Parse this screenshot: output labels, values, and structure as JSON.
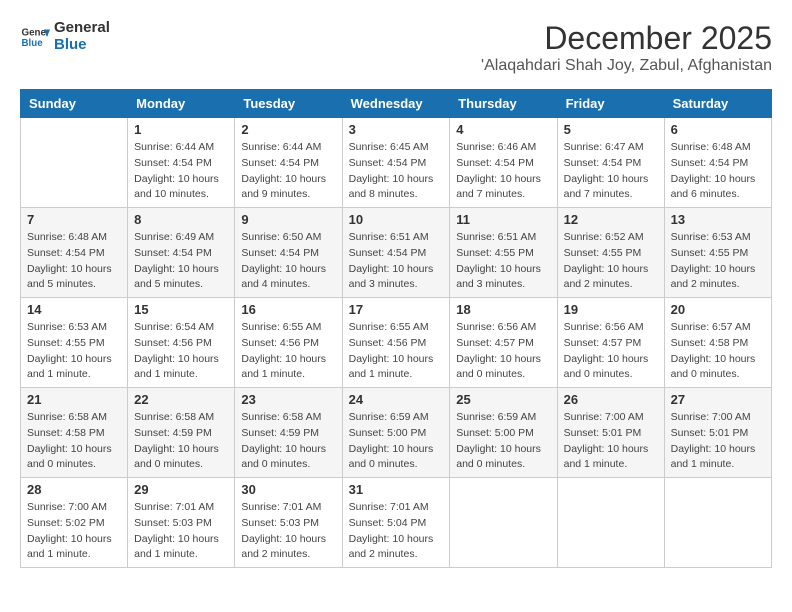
{
  "logo": {
    "line1": "General",
    "line2": "Blue"
  },
  "title": "December 2025",
  "location": "'Alaqahdari Shah Joy, Zabul, Afghanistan",
  "weekdays": [
    "Sunday",
    "Monday",
    "Tuesday",
    "Wednesday",
    "Thursday",
    "Friday",
    "Saturday"
  ],
  "weeks": [
    [
      null,
      {
        "day": 1,
        "sunrise": "6:44 AM",
        "sunset": "4:54 PM",
        "daylight": "10 hours and 10 minutes."
      },
      {
        "day": 2,
        "sunrise": "6:44 AM",
        "sunset": "4:54 PM",
        "daylight": "10 hours and 9 minutes."
      },
      {
        "day": 3,
        "sunrise": "6:45 AM",
        "sunset": "4:54 PM",
        "daylight": "10 hours and 8 minutes."
      },
      {
        "day": 4,
        "sunrise": "6:46 AM",
        "sunset": "4:54 PM",
        "daylight": "10 hours and 7 minutes."
      },
      {
        "day": 5,
        "sunrise": "6:47 AM",
        "sunset": "4:54 PM",
        "daylight": "10 hours and 7 minutes."
      },
      {
        "day": 6,
        "sunrise": "6:48 AM",
        "sunset": "4:54 PM",
        "daylight": "10 hours and 6 minutes."
      }
    ],
    [
      {
        "day": 7,
        "sunrise": "6:48 AM",
        "sunset": "4:54 PM",
        "daylight": "10 hours and 5 minutes."
      },
      {
        "day": 8,
        "sunrise": "6:49 AM",
        "sunset": "4:54 PM",
        "daylight": "10 hours and 5 minutes."
      },
      {
        "day": 9,
        "sunrise": "6:50 AM",
        "sunset": "4:54 PM",
        "daylight": "10 hours and 4 minutes."
      },
      {
        "day": 10,
        "sunrise": "6:51 AM",
        "sunset": "4:54 PM",
        "daylight": "10 hours and 3 minutes."
      },
      {
        "day": 11,
        "sunrise": "6:51 AM",
        "sunset": "4:55 PM",
        "daylight": "10 hours and 3 minutes."
      },
      {
        "day": 12,
        "sunrise": "6:52 AM",
        "sunset": "4:55 PM",
        "daylight": "10 hours and 2 minutes."
      },
      {
        "day": 13,
        "sunrise": "6:53 AM",
        "sunset": "4:55 PM",
        "daylight": "10 hours and 2 minutes."
      }
    ],
    [
      {
        "day": 14,
        "sunrise": "6:53 AM",
        "sunset": "4:55 PM",
        "daylight": "10 hours and 1 minute."
      },
      {
        "day": 15,
        "sunrise": "6:54 AM",
        "sunset": "4:56 PM",
        "daylight": "10 hours and 1 minute."
      },
      {
        "day": 16,
        "sunrise": "6:55 AM",
        "sunset": "4:56 PM",
        "daylight": "10 hours and 1 minute."
      },
      {
        "day": 17,
        "sunrise": "6:55 AM",
        "sunset": "4:56 PM",
        "daylight": "10 hours and 1 minute."
      },
      {
        "day": 18,
        "sunrise": "6:56 AM",
        "sunset": "4:57 PM",
        "daylight": "10 hours and 0 minutes."
      },
      {
        "day": 19,
        "sunrise": "6:56 AM",
        "sunset": "4:57 PM",
        "daylight": "10 hours and 0 minutes."
      },
      {
        "day": 20,
        "sunrise": "6:57 AM",
        "sunset": "4:58 PM",
        "daylight": "10 hours and 0 minutes."
      }
    ],
    [
      {
        "day": 21,
        "sunrise": "6:58 AM",
        "sunset": "4:58 PM",
        "daylight": "10 hours and 0 minutes."
      },
      {
        "day": 22,
        "sunrise": "6:58 AM",
        "sunset": "4:59 PM",
        "daylight": "10 hours and 0 minutes."
      },
      {
        "day": 23,
        "sunrise": "6:58 AM",
        "sunset": "4:59 PM",
        "daylight": "10 hours and 0 minutes."
      },
      {
        "day": 24,
        "sunrise": "6:59 AM",
        "sunset": "5:00 PM",
        "daylight": "10 hours and 0 minutes."
      },
      {
        "day": 25,
        "sunrise": "6:59 AM",
        "sunset": "5:00 PM",
        "daylight": "10 hours and 0 minutes."
      },
      {
        "day": 26,
        "sunrise": "7:00 AM",
        "sunset": "5:01 PM",
        "daylight": "10 hours and 1 minute."
      },
      {
        "day": 27,
        "sunrise": "7:00 AM",
        "sunset": "5:01 PM",
        "daylight": "10 hours and 1 minute."
      }
    ],
    [
      {
        "day": 28,
        "sunrise": "7:00 AM",
        "sunset": "5:02 PM",
        "daylight": "10 hours and 1 minute."
      },
      {
        "day": 29,
        "sunrise": "7:01 AM",
        "sunset": "5:03 PM",
        "daylight": "10 hours and 1 minute."
      },
      {
        "day": 30,
        "sunrise": "7:01 AM",
        "sunset": "5:03 PM",
        "daylight": "10 hours and 2 minutes."
      },
      {
        "day": 31,
        "sunrise": "7:01 AM",
        "sunset": "5:04 PM",
        "daylight": "10 hours and 2 minutes."
      },
      null,
      null,
      null
    ]
  ]
}
